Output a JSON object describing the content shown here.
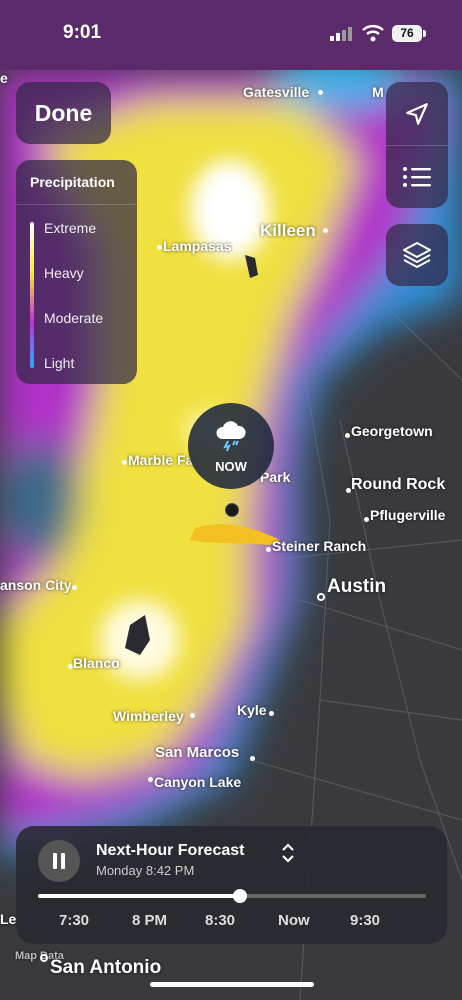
{
  "status_bar": {
    "time": "9:01",
    "battery": "76"
  },
  "done_label": "Done",
  "legend": {
    "title": "Precipitation",
    "levels": [
      "Extreme",
      "Heavy",
      "Moderate",
      "Light"
    ]
  },
  "map_labels": {
    "gatesville": "Gatesville",
    "killeen": "Killeen",
    "lampasas": "Lampasas",
    "georgetown": "Georgetown",
    "marble_falls": "Marble Fa",
    "park": "Park",
    "round_rock": "Round Rock",
    "pflugerville": "Pflugerville",
    "steiner_ranch": "Steiner Ranch",
    "austin": "Austin",
    "benson_city": "anson City",
    "blanco": "Blanco",
    "kyle": "Kyle",
    "wimberley": "Wimberley",
    "san_marcos": "San Marcos",
    "canyon_lake": "Canyon Lake",
    "san_antonio": "San Antonio",
    "map_data": "Map Data",
    "edge_m": "M",
    "edge_e": "e",
    "edge_le": "Le"
  },
  "now_marker": {
    "label": "NOW",
    "icon": "thunderstorm-cloud-icon"
  },
  "forecast": {
    "title": "Next-Hour Forecast",
    "subtitle": "Monday 8:42 PM",
    "progress": 0.52,
    "ticks": [
      "7:30",
      "8 PM",
      "8:30",
      "Now",
      "9:30"
    ]
  },
  "colors": {
    "extreme": "#ffffff",
    "heavy": "#f5e84a",
    "moderate": "#c030d8",
    "light": "#30a8ff",
    "base_map": "#3a3a3e"
  }
}
